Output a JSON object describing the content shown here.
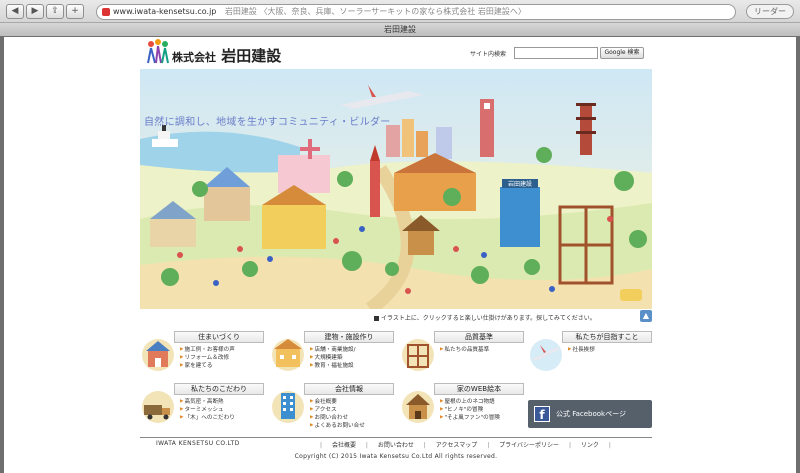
{
  "browser": {
    "url": "www.iwata-kensetsu.co.jp",
    "page_title": "岩田建設 〈大阪、奈良、兵庫、ソーラーサーキットの家なら株式会社 岩田建設へ〉",
    "tab_title": "岩田建設",
    "reader_label": "リーダー"
  },
  "header": {
    "company_prefix": "株式会社",
    "company_name": "岩田建設",
    "search_label": "サイト内検索",
    "search_button": "Google 検索"
  },
  "hero": {
    "tagline": "自然に調和し、地域を生かすコミュニティ・ビルダー",
    "station_sign": "岩田建設",
    "hint": "イラスト上に、クリックすると楽しい仕掛けがあります。探してみてください。"
  },
  "menu": [
    {
      "title": "住まいづくり",
      "links": [
        "施工例・お客様の声",
        "リフォーム＆改修",
        "家を建てる"
      ]
    },
    {
      "title": "建物・施設作り",
      "links": [
        "店舗・商業施設/",
        "大規模建築",
        "教育・福祉施設"
      ]
    },
    {
      "title": "品質基準",
      "links": [
        "私たちの品質基準"
      ]
    },
    {
      "title": "私たちが目指すこと",
      "links": [
        "社長挨拶"
      ]
    },
    {
      "title": "私たちのこだわり",
      "links": [
        "高気密・高断熱",
        "ターミメッシュ",
        "「木」へのこだわり"
      ]
    },
    {
      "title": "会社情報",
      "links": [
        "会社概要",
        "アクセス",
        "お問い合わせ",
        "よくあるお問い合せ"
      ]
    },
    {
      "title": "家のWEB絵本",
      "links": [
        "屋根の上のネコ物語",
        "\"ヒノキ\"の冒険",
        "\"そよ風ファン\"の冒険"
      ]
    }
  ],
  "facebook_label": "公式 Facebookページ",
  "footer": {
    "company": "IWATA KENSETSU CO.LTD",
    "links": [
      "会社概要",
      "お問い合わせ",
      "アクセスマップ",
      "プライバシーポリシー",
      "リンク"
    ],
    "copyright": "Copyright (C) 2015 Iwata Kensetsu Co.Ltd All rights reserved."
  },
  "colors": {
    "accent_orange": "#e08a2a",
    "tagline_blue": "#6a7dc9",
    "facebook": "#3b5998"
  }
}
